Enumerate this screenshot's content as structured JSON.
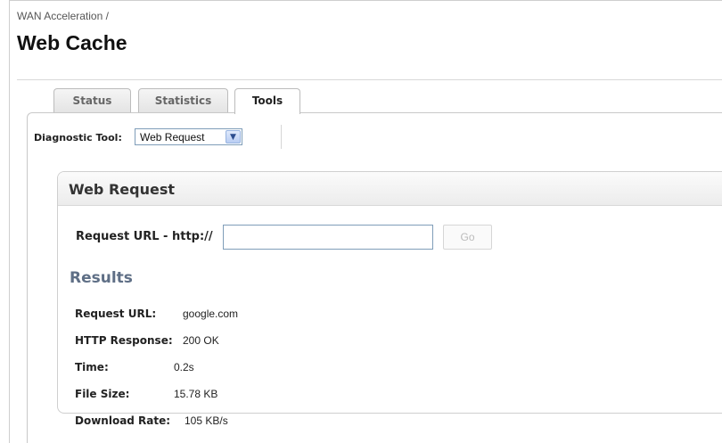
{
  "breadcrumb": "WAN Acceleration /",
  "page_title": "Web Cache",
  "tabs": [
    {
      "label": "Status",
      "active": false
    },
    {
      "label": "Statistics",
      "active": false
    },
    {
      "label": "Tools",
      "active": true
    }
  ],
  "diagnostic": {
    "label": "Diagnostic Tool:",
    "selected": "Web Request"
  },
  "panel": {
    "title": "Web Request",
    "request_label": "Request URL - http://",
    "request_value": "",
    "go_label": "Go"
  },
  "results": {
    "title": "Results",
    "rows": [
      {
        "label": "Request URL:",
        "value": "google.com"
      },
      {
        "label": "HTTP Response:",
        "value": "200 OK"
      },
      {
        "label": "Time:",
        "value": "0.2s"
      },
      {
        "label": "File Size:",
        "value": "15.78 KB"
      },
      {
        "label": "Download Rate:",
        "value": "105 KB/s"
      }
    ]
  },
  "colors": {
    "results_title": "#5f6f86",
    "select_border": "#7f9db9"
  }
}
